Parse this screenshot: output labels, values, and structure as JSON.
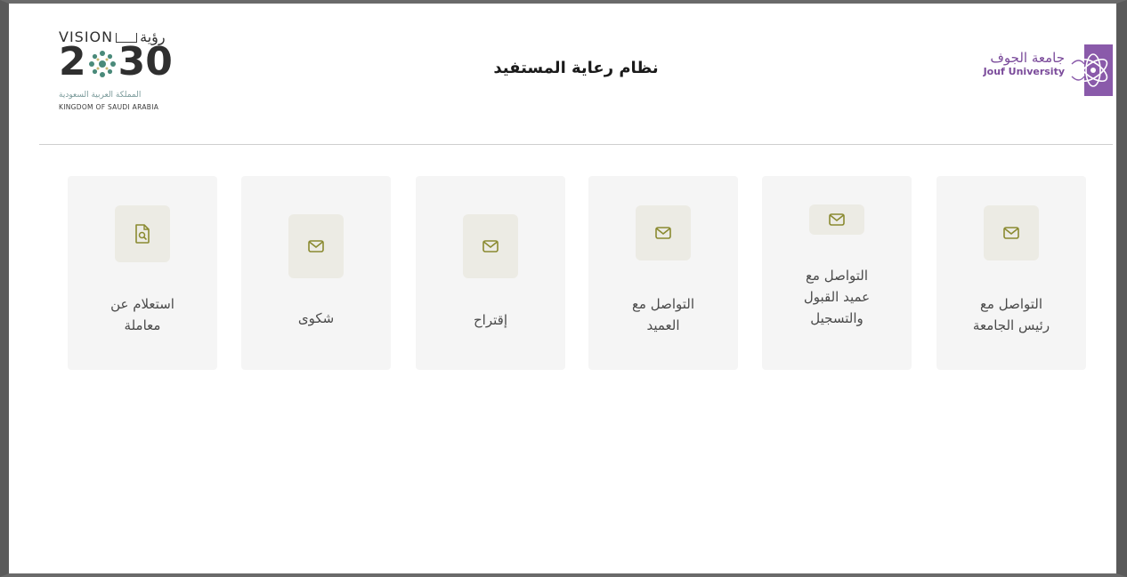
{
  "header": {
    "title": "نظام رعاية المستفيد",
    "vision_logo": {
      "top_latin": "VISION",
      "top_arabic": "رؤية",
      "year_a": "2",
      "year_b": "30",
      "line_ar": "المملكة العربية السعودية",
      "line_en": "KINGDOM OF SAUDI ARABIA"
    },
    "university_logo": {
      "name_ar": "جامعة الجوف",
      "name_en": "Jouf University",
      "color": "#7a4a9a"
    }
  },
  "cards": [
    {
      "id": "president",
      "label_lines": [
        "التواصل مع",
        "رئيس الجامعة"
      ],
      "icon": "envelope-icon"
    },
    {
      "id": "admission-dean",
      "label_lines": [
        "التواصل مع",
        "عميد القبول",
        "والتسجيل"
      ],
      "icon": "envelope-icon"
    },
    {
      "id": "dean",
      "label_lines": [
        "التواصل مع",
        "العميد"
      ],
      "icon": "envelope-icon"
    },
    {
      "id": "suggestion",
      "label_lines": [
        "إقتراح"
      ],
      "icon": "envelope-icon"
    },
    {
      "id": "complaint",
      "label_lines": [
        "شكوى"
      ],
      "icon": "envelope-icon"
    },
    {
      "id": "inquiry",
      "label_lines": [
        "استعلام عن",
        "معاملة"
      ],
      "icon": "document-search-icon"
    }
  ],
  "colors": {
    "icon_stroke": "#8a8a30",
    "card_bg": "#f5f5f5",
    "icon_bg": "#ecebe4"
  }
}
